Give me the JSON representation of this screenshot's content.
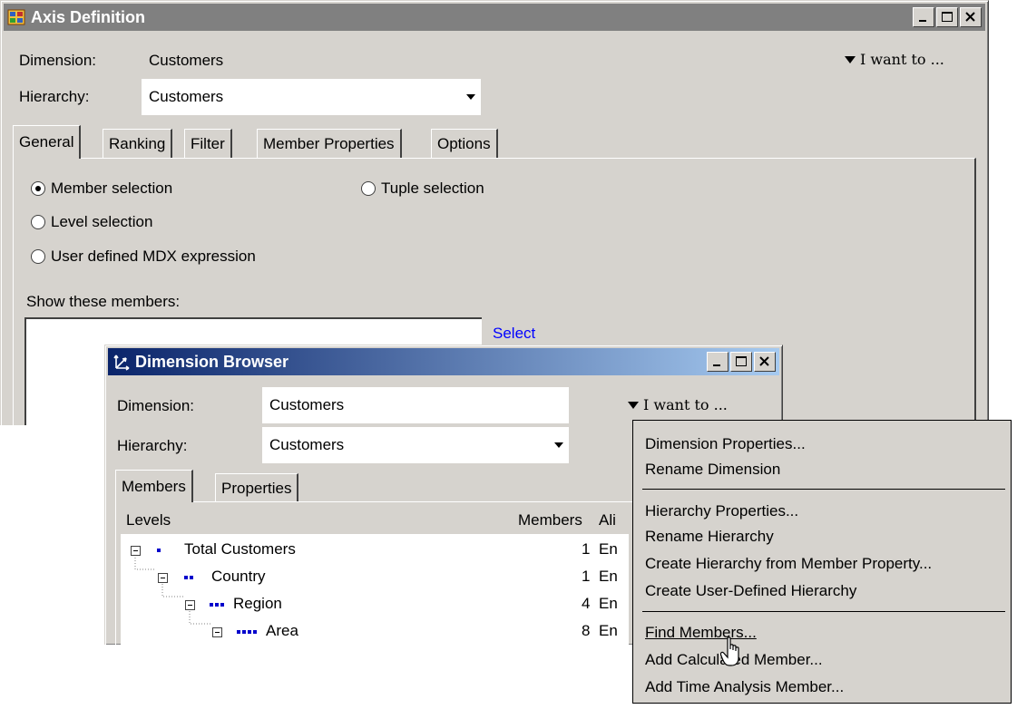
{
  "axis_window": {
    "title": "Axis Definition",
    "dimension_label": "Dimension:",
    "dimension_value": "Customers",
    "i_want_to": "I want to ...",
    "hierarchy_label": "Hierarchy:",
    "hierarchy_value": "Customers",
    "tabs": [
      {
        "label": "General"
      },
      {
        "label": "Ranking"
      },
      {
        "label": "Filter"
      },
      {
        "label": "Member Properties"
      },
      {
        "label": "Options"
      }
    ],
    "radios": {
      "member_selection": "Member selection",
      "tuple_selection": "Tuple selection",
      "level_selection": "Level selection",
      "user_defined_mdx": "User defined MDX expression"
    },
    "show_members_label": "Show these members:",
    "select_link": "Select"
  },
  "browser_window": {
    "title": "Dimension Browser",
    "dimension_label": "Dimension:",
    "dimension_value": "Customers",
    "i_want_to": "I want to ...",
    "hierarchy_label": "Hierarchy:",
    "hierarchy_value": "Customers",
    "tabs": [
      {
        "label": "Members"
      },
      {
        "label": "Properties"
      }
    ],
    "columns": {
      "levels": "Levels",
      "members": "Members",
      "alias": "Ali"
    },
    "rows": [
      {
        "name": "Total Customers",
        "members": "1",
        "alias": "En"
      },
      {
        "name": "Country",
        "members": "1",
        "alias": "En"
      },
      {
        "name": "Region",
        "members": "4",
        "alias": "En"
      },
      {
        "name": "Area",
        "members": "8",
        "alias": "En"
      }
    ]
  },
  "menu": {
    "items": [
      "Dimension Properties...",
      "Rename Dimension",
      "Hierarchy Properties...",
      "Rename Hierarchy",
      "Create Hierarchy from Member Property...",
      "Create User-Defined Hierarchy",
      "Find Members...",
      "Add Calculated Member...",
      "Add Time Analysis Member..."
    ]
  },
  "colors": {
    "dialog_bg": "#d6d3ce",
    "active_title": "#0a246a",
    "inactive_title": "#808080",
    "link": "#0000ff",
    "level_dot": "#0000cc"
  }
}
